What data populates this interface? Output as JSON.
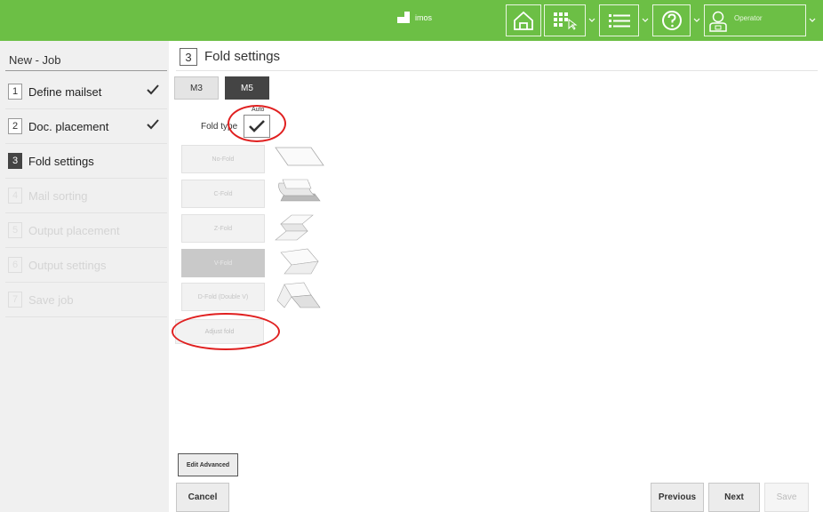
{
  "app": {
    "logo_text": "imos"
  },
  "topbar": {
    "icons": [
      "home-icon",
      "grid-pointer-icon",
      "list-icon",
      "help-icon",
      "operator-icon"
    ],
    "user_label": "Operator"
  },
  "sidebar": {
    "title": "New - Job",
    "steps": [
      {
        "num": "1",
        "label": "Define mailset",
        "state": "done"
      },
      {
        "num": "2",
        "label": "Doc. placement",
        "state": "done"
      },
      {
        "num": "3",
        "label": "Fold settings",
        "state": "active"
      },
      {
        "num": "4",
        "label": "Mail sorting",
        "state": "disabled"
      },
      {
        "num": "5",
        "label": "Output placement",
        "state": "disabled"
      },
      {
        "num": "6",
        "label": "Output settings",
        "state": "disabled"
      },
      {
        "num": "7",
        "label": "Save job",
        "state": "disabled"
      }
    ]
  },
  "main": {
    "step_num": "3",
    "title": "Fold settings",
    "tabs": [
      {
        "label": "M3",
        "selected": false
      },
      {
        "label": "M5",
        "selected": true
      }
    ],
    "auto_label": "Auto",
    "fold_type_label": "Fold type",
    "auto_checked": true,
    "fold_options": [
      {
        "label": "No-Fold",
        "selected": false,
        "icon": "no-fold-icon"
      },
      {
        "label": "C-Fold",
        "selected": false,
        "icon": "c-fold-icon"
      },
      {
        "label": "Z-Fold",
        "selected": false,
        "icon": "z-fold-icon"
      },
      {
        "label": "V-Fold",
        "selected": true,
        "icon": "v-fold-icon"
      },
      {
        "label": "D-Fold (Double V)",
        "selected": false,
        "icon": "d-fold-icon"
      }
    ],
    "adjust_label": "Adjust fold",
    "edit_advanced_label": "Edit Advanced"
  },
  "footer": {
    "cancel": "Cancel",
    "previous": "Previous",
    "next": "Next",
    "save": "Save"
  },
  "colors": {
    "brand_green": "#6cbf45",
    "annotation_red": "#e02020"
  }
}
